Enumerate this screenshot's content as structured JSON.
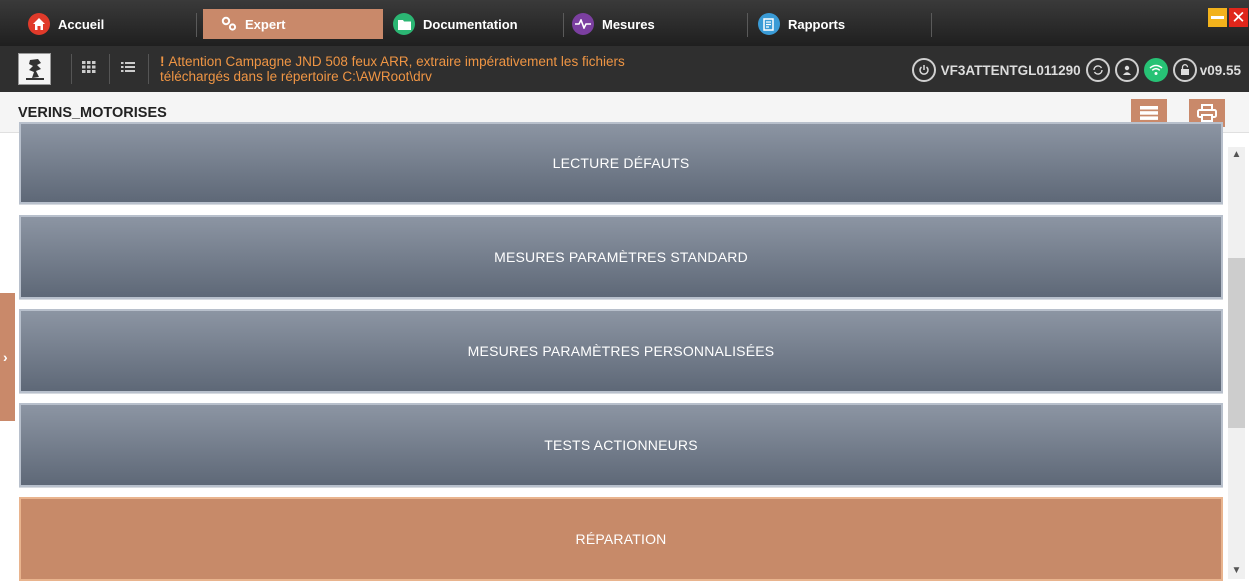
{
  "tabs": [
    {
      "label": "Accueil",
      "icon": "home-icon"
    },
    {
      "label": "Expert",
      "icon": "gears-icon"
    },
    {
      "label": "Documentation",
      "icon": "folder-icon"
    },
    {
      "label": "Mesures",
      "icon": "waveform-icon"
    },
    {
      "label": "Rapports",
      "icon": "report-icon"
    }
  ],
  "active_tab": "Expert",
  "infobar": {
    "warning_line1": "Attention Campagne JND 508 feux ARR, extraire impérativement les fichiers",
    "warning_line2": "téléchargés dans le répertoire C:\\AWRoot\\drv",
    "warning_mark": "!",
    "vin": "VF3ATTENTGL011290",
    "version": "v09.55"
  },
  "page": {
    "title": "VERINS_MOTORISES"
  },
  "menu": [
    {
      "label": "LECTURE DÉFAUTS"
    },
    {
      "label": "MESURES PARAMÈTRES STANDARD"
    },
    {
      "label": "MESURES PARAMÈTRES PERSONNALISÉES"
    },
    {
      "label": "TESTS ACTIONNEURS"
    },
    {
      "label": "RÉPARATION"
    }
  ],
  "colors": {
    "accent": "#c9896a",
    "warning": "#ef9544",
    "menu_button": "#6f7887",
    "connected": "#27c275"
  }
}
